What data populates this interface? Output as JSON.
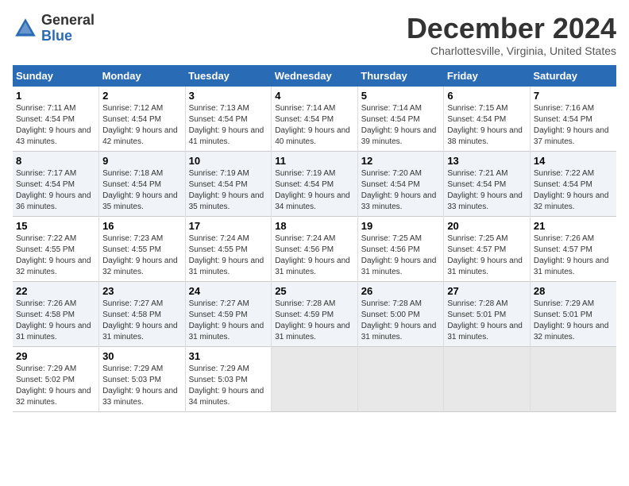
{
  "header": {
    "logo_line1": "General",
    "logo_line2": "Blue",
    "month": "December 2024",
    "location": "Charlottesville, Virginia, United States"
  },
  "weekdays": [
    "Sunday",
    "Monday",
    "Tuesday",
    "Wednesday",
    "Thursday",
    "Friday",
    "Saturday"
  ],
  "weeks": [
    [
      {
        "day": "1",
        "sunrise": "Sunrise: 7:11 AM",
        "sunset": "Sunset: 4:54 PM",
        "daylight": "Daylight: 9 hours and 43 minutes."
      },
      {
        "day": "2",
        "sunrise": "Sunrise: 7:12 AM",
        "sunset": "Sunset: 4:54 PM",
        "daylight": "Daylight: 9 hours and 42 minutes."
      },
      {
        "day": "3",
        "sunrise": "Sunrise: 7:13 AM",
        "sunset": "Sunset: 4:54 PM",
        "daylight": "Daylight: 9 hours and 41 minutes."
      },
      {
        "day": "4",
        "sunrise": "Sunrise: 7:14 AM",
        "sunset": "Sunset: 4:54 PM",
        "daylight": "Daylight: 9 hours and 40 minutes."
      },
      {
        "day": "5",
        "sunrise": "Sunrise: 7:14 AM",
        "sunset": "Sunset: 4:54 PM",
        "daylight": "Daylight: 9 hours and 39 minutes."
      },
      {
        "day": "6",
        "sunrise": "Sunrise: 7:15 AM",
        "sunset": "Sunset: 4:54 PM",
        "daylight": "Daylight: 9 hours and 38 minutes."
      },
      {
        "day": "7",
        "sunrise": "Sunrise: 7:16 AM",
        "sunset": "Sunset: 4:54 PM",
        "daylight": "Daylight: 9 hours and 37 minutes."
      }
    ],
    [
      {
        "day": "8",
        "sunrise": "Sunrise: 7:17 AM",
        "sunset": "Sunset: 4:54 PM",
        "daylight": "Daylight: 9 hours and 36 minutes."
      },
      {
        "day": "9",
        "sunrise": "Sunrise: 7:18 AM",
        "sunset": "Sunset: 4:54 PM",
        "daylight": "Daylight: 9 hours and 35 minutes."
      },
      {
        "day": "10",
        "sunrise": "Sunrise: 7:19 AM",
        "sunset": "Sunset: 4:54 PM",
        "daylight": "Daylight: 9 hours and 35 minutes."
      },
      {
        "day": "11",
        "sunrise": "Sunrise: 7:19 AM",
        "sunset": "Sunset: 4:54 PM",
        "daylight": "Daylight: 9 hours and 34 minutes."
      },
      {
        "day": "12",
        "sunrise": "Sunrise: 7:20 AM",
        "sunset": "Sunset: 4:54 PM",
        "daylight": "Daylight: 9 hours and 33 minutes."
      },
      {
        "day": "13",
        "sunrise": "Sunrise: 7:21 AM",
        "sunset": "Sunset: 4:54 PM",
        "daylight": "Daylight: 9 hours and 33 minutes."
      },
      {
        "day": "14",
        "sunrise": "Sunrise: 7:22 AM",
        "sunset": "Sunset: 4:54 PM",
        "daylight": "Daylight: 9 hours and 32 minutes."
      }
    ],
    [
      {
        "day": "15",
        "sunrise": "Sunrise: 7:22 AM",
        "sunset": "Sunset: 4:55 PM",
        "daylight": "Daylight: 9 hours and 32 minutes."
      },
      {
        "day": "16",
        "sunrise": "Sunrise: 7:23 AM",
        "sunset": "Sunset: 4:55 PM",
        "daylight": "Daylight: 9 hours and 32 minutes."
      },
      {
        "day": "17",
        "sunrise": "Sunrise: 7:24 AM",
        "sunset": "Sunset: 4:55 PM",
        "daylight": "Daylight: 9 hours and 31 minutes."
      },
      {
        "day": "18",
        "sunrise": "Sunrise: 7:24 AM",
        "sunset": "Sunset: 4:56 PM",
        "daylight": "Daylight: 9 hours and 31 minutes."
      },
      {
        "day": "19",
        "sunrise": "Sunrise: 7:25 AM",
        "sunset": "Sunset: 4:56 PM",
        "daylight": "Daylight: 9 hours and 31 minutes."
      },
      {
        "day": "20",
        "sunrise": "Sunrise: 7:25 AM",
        "sunset": "Sunset: 4:57 PM",
        "daylight": "Daylight: 9 hours and 31 minutes."
      },
      {
        "day": "21",
        "sunrise": "Sunrise: 7:26 AM",
        "sunset": "Sunset: 4:57 PM",
        "daylight": "Daylight: 9 hours and 31 minutes."
      }
    ],
    [
      {
        "day": "22",
        "sunrise": "Sunrise: 7:26 AM",
        "sunset": "Sunset: 4:58 PM",
        "daylight": "Daylight: 9 hours and 31 minutes."
      },
      {
        "day": "23",
        "sunrise": "Sunrise: 7:27 AM",
        "sunset": "Sunset: 4:58 PM",
        "daylight": "Daylight: 9 hours and 31 minutes."
      },
      {
        "day": "24",
        "sunrise": "Sunrise: 7:27 AM",
        "sunset": "Sunset: 4:59 PM",
        "daylight": "Daylight: 9 hours and 31 minutes."
      },
      {
        "day": "25",
        "sunrise": "Sunrise: 7:28 AM",
        "sunset": "Sunset: 4:59 PM",
        "daylight": "Daylight: 9 hours and 31 minutes."
      },
      {
        "day": "26",
        "sunrise": "Sunrise: 7:28 AM",
        "sunset": "Sunset: 5:00 PM",
        "daylight": "Daylight: 9 hours and 31 minutes."
      },
      {
        "day": "27",
        "sunrise": "Sunrise: 7:28 AM",
        "sunset": "Sunset: 5:01 PM",
        "daylight": "Daylight: 9 hours and 31 minutes."
      },
      {
        "day": "28",
        "sunrise": "Sunrise: 7:29 AM",
        "sunset": "Sunset: 5:01 PM",
        "daylight": "Daylight: 9 hours and 32 minutes."
      }
    ],
    [
      {
        "day": "29",
        "sunrise": "Sunrise: 7:29 AM",
        "sunset": "Sunset: 5:02 PM",
        "daylight": "Daylight: 9 hours and 32 minutes."
      },
      {
        "day": "30",
        "sunrise": "Sunrise: 7:29 AM",
        "sunset": "Sunset: 5:03 PM",
        "daylight": "Daylight: 9 hours and 33 minutes."
      },
      {
        "day": "31",
        "sunrise": "Sunrise: 7:29 AM",
        "sunset": "Sunset: 5:03 PM",
        "daylight": "Daylight: 9 hours and 34 minutes."
      },
      null,
      null,
      null,
      null
    ]
  ]
}
